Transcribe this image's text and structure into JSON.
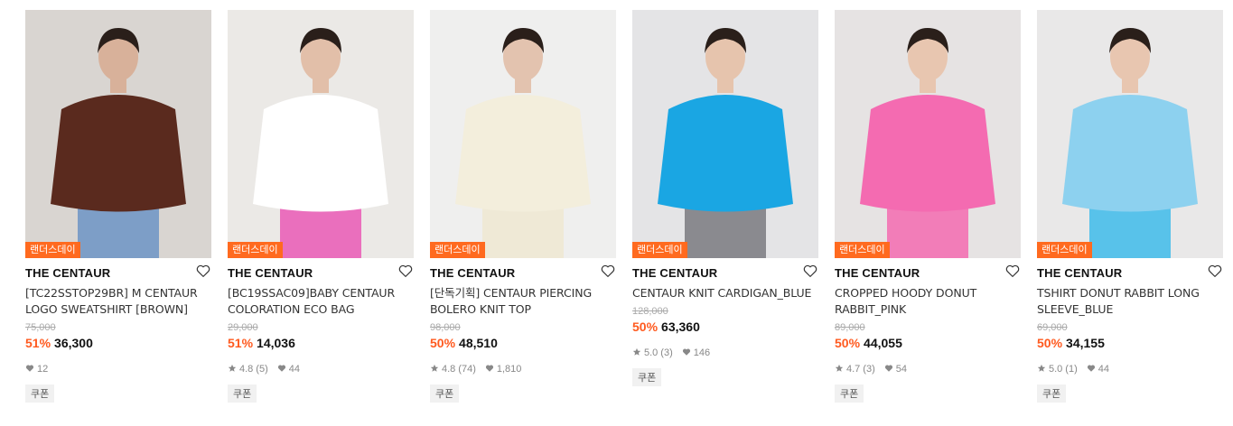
{
  "products": [
    {
      "badge": "랜더스데이",
      "brand": "THE CENTAUR",
      "title_lines": [
        "[TC22SSTOP29BR] M CENTAUR",
        "LOGO SWEATSHIRT [BROWN]"
      ],
      "original_price": "75,000",
      "discount": "51%",
      "price": "36,300",
      "rating": "",
      "review_count": "",
      "likes": "12",
      "coupon": "쿠폰",
      "colors": {
        "bg": "#d9d5d1",
        "top": "#5a2a1e",
        "bottom": "#7d9ec7",
        "skin": "#d8b19a"
      }
    },
    {
      "badge": "랜더스데이",
      "brand": "THE CENTAUR",
      "title_lines": [
        "[BC19SSAC09]BABY CENTAUR",
        "COLORATION ECO BAG"
      ],
      "original_price": "29,000",
      "discount": "51%",
      "price": "14,036",
      "rating": "4.8",
      "review_count": "(5)",
      "likes": "44",
      "coupon": "쿠폰",
      "colors": {
        "bg": "#ebe9e6",
        "top": "#ffffff",
        "bottom": "#ea6fbd",
        "skin": "#e2bfa9"
      }
    },
    {
      "badge": "랜더스데이",
      "brand": "THE CENTAUR",
      "title_lines": [
        "[단독기획] CENTAUR PIERCING",
        "BOLERO KNIT TOP"
      ],
      "original_price": "98,000",
      "discount": "50%",
      "price": "48,510",
      "rating": "4.8",
      "review_count": "(74)",
      "likes": "1,810",
      "coupon": "쿠폰",
      "colors": {
        "bg": "#efefee",
        "top": "#f3eedc",
        "bottom": "#efe9d6",
        "skin": "#e3c3af"
      }
    },
    {
      "badge": "랜더스데이",
      "brand": "THE CENTAUR",
      "title_lines": [
        "CENTAUR KNIT CARDIGAN_BLUE"
      ],
      "original_price": "128,000",
      "discount": "50%",
      "price": "63,360",
      "rating": "5.0",
      "review_count": "(3)",
      "likes": "146",
      "coupon": "쿠폰",
      "colors": {
        "bg": "#e4e4e6",
        "top": "#1aa6e3",
        "bottom": "#8a8a8f",
        "skin": "#e6c4ad"
      }
    },
    {
      "badge": "랜더스데이",
      "brand": "THE CENTAUR",
      "title_lines": [
        "CROPPED HOODY DONUT",
        "RABBIT_PINK"
      ],
      "original_price": "89,000",
      "discount": "50%",
      "price": "44,055",
      "rating": "4.7",
      "review_count": "(3)",
      "likes": "54",
      "coupon": "쿠폰",
      "colors": {
        "bg": "#e6e3e3",
        "top": "#f46bb1",
        "bottom": "#f27db8",
        "skin": "#e8c6b0"
      }
    },
    {
      "badge": "랜더스데이",
      "brand": "THE CENTAUR",
      "title_lines": [
        "TSHIRT DONUT RABBIT LONG",
        "SLEEVE_BLUE"
      ],
      "original_price": "69,000",
      "discount": "50%",
      "price": "34,155",
      "rating": "5.0",
      "review_count": "(1)",
      "likes": "44",
      "coupon": "쿠폰",
      "colors": {
        "bg": "#e9e8e8",
        "top": "#8dd1ef",
        "bottom": "#58c2ea",
        "skin": "#e8c6b0"
      }
    }
  ]
}
